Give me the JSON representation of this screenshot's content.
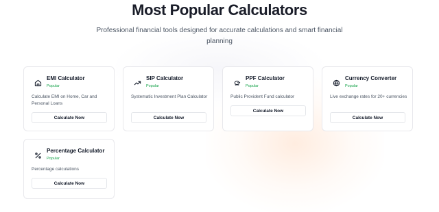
{
  "heading": "Most Popular Calculators",
  "subtitle": "Professional financial tools designed for accurate calculations and smart financial planning",
  "badge_color": "#16a34a",
  "cards": [
    {
      "title": "EMI Calculator",
      "badge": "Popular",
      "icon": "home-icon",
      "description": "Calculate EMI on Home, Car and Personal Loans",
      "button": "Calculate Now"
    },
    {
      "title": "SIP Calculator",
      "badge": "Popular",
      "icon": "trending-up-icon",
      "description": "Systematic Investment Plan Calculator",
      "button": "Calculate Now"
    },
    {
      "title": "PPF Calculator",
      "badge": "Popular",
      "icon": "piggy-bank-icon",
      "description": "Public Provident Fund calculator",
      "button": "Calculate Now"
    },
    {
      "title": "Currency Converter",
      "badge": "Popular",
      "icon": "globe-icon",
      "description": "Live exchange rates for 20+ currencies",
      "button": "Calculate Now"
    },
    {
      "title": "Percentage Calculator",
      "badge": "Popular",
      "icon": "percent-icon",
      "description": "Percentage calculations",
      "button": "Calculate Now"
    }
  ]
}
